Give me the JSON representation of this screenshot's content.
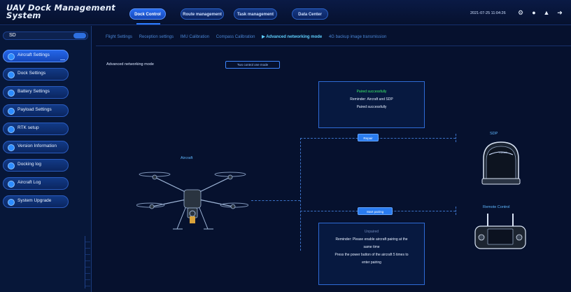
{
  "header": {
    "logo_line1": "UAV Dock Management",
    "logo_line2": "System",
    "nav": [
      "Dock Control",
      "Route management",
      "Task management",
      "Data Center"
    ],
    "datetime": "2021-07-25 11:04:26"
  },
  "sidebar": {
    "search_value": "SD",
    "items": [
      {
        "label": "Aircraft Settings"
      },
      {
        "label": "Dock Settings"
      },
      {
        "label": "Battery Settings"
      },
      {
        "label": "Payload Settings"
      },
      {
        "label": "RTK setup"
      },
      {
        "label": "Version Information"
      },
      {
        "label": "Docking log"
      },
      {
        "label": "Aircraft Log"
      },
      {
        "label": "System Upgrade"
      }
    ]
  },
  "tabs": [
    "Flight Settings",
    "Reception settings",
    "IMU Calibration",
    "Compass Calibration",
    "Advanced networking mode",
    "4G backup image transmission"
  ],
  "main": {
    "adv_label": "Advanced networking mode",
    "one_mode_btn": "Two control one mode",
    "aircraft_label": "Aircraft",
    "sdp_label": "SDP",
    "rc_label": "Remote Control",
    "card1": {
      "status": "Paired successfully",
      "reminder": "Reminder: Aircraft and SDP",
      "result": "Paired successfully"
    },
    "repair_btn": "Repair",
    "pairing_btn": "Start pairing",
    "card2": {
      "status": "Unpaired",
      "line1": "Reminder: Please enable aircraft pairing at the",
      "line2": "same time",
      "line3": "Press the power button of the aircraft 5 times to",
      "line4": "enter pairing"
    }
  },
  "colors": {
    "accent": "#2c7bff",
    "success": "#3cf06a",
    "background": "#06112e"
  }
}
